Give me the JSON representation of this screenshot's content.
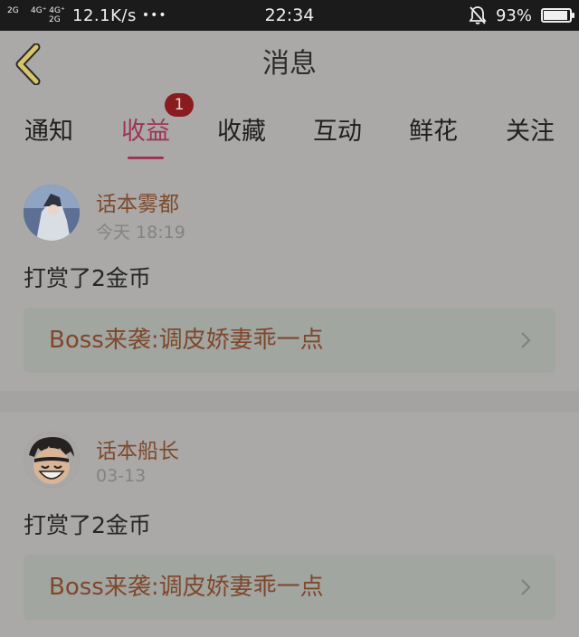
{
  "status_bar": {
    "sim1_tag": "2G",
    "sim2_tag_top": "4G⁺ 4G⁺",
    "sim2_tag_bottom": "2G",
    "speed": "12.1K/s",
    "dots": "•••",
    "time": "22:34",
    "battery_text": "93%",
    "battery_level": 0.93
  },
  "nav": {
    "title": "消息",
    "back_icon": "chevron-left-icon",
    "accent": "#d8c46a"
  },
  "tabs": [
    {
      "label": "通知"
    },
    {
      "label": "收益",
      "active": true
    },
    {
      "label": "收藏"
    },
    {
      "label": "互动"
    },
    {
      "label": "鲜花"
    },
    {
      "label": "关注"
    }
  ],
  "tab_badge": "1",
  "colors": {
    "active_tab": "#9c3556",
    "name": "#7e4a2c",
    "story": "#80472d"
  },
  "notifications": [
    {
      "user": "话本雾都",
      "time": "今天 18:19",
      "message": "打赏了2金币",
      "story": "Boss来袭:调皮娇妻乖一点"
    },
    {
      "user": "话本船长",
      "time": "03-13",
      "message": "打赏了2金币",
      "story": "Boss来袭:调皮娇妻乖一点"
    }
  ]
}
